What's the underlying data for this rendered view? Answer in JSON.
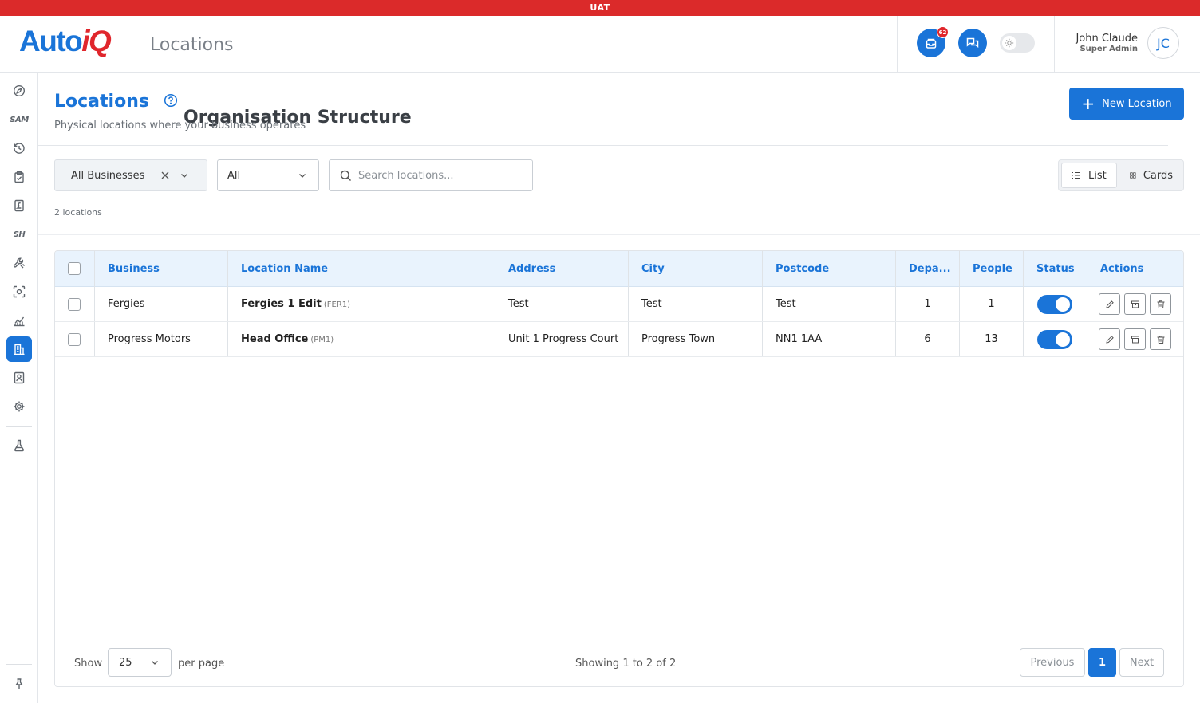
{
  "env": {
    "label": "UAT"
  },
  "brand": {
    "logo_auto": "Auto",
    "logo_iq": "iQ",
    "primary_color": "#1a74d8",
    "accent_color": "#e0262c",
    "env_color": "#db2a2a"
  },
  "header": {
    "title": "Organisation Structure",
    "subtitle": "Locations",
    "notification_count": "62",
    "user": {
      "name": "John Claude",
      "role": "Super Admin",
      "initials": "JC"
    }
  },
  "sidebar": {
    "items": [
      {
        "icon": "compass-icon"
      },
      {
        "text": "SAM"
      },
      {
        "icon": "history-icon"
      },
      {
        "icon": "clipboard-icon"
      },
      {
        "icon": "pound-invoice-icon"
      },
      {
        "text": "SH"
      },
      {
        "icon": "tools-icon"
      },
      {
        "icon": "scan-icon"
      },
      {
        "icon": "analytics-icon"
      },
      {
        "icon": "building-icon",
        "active": true
      },
      {
        "icon": "contact-book-icon"
      },
      {
        "icon": "gear-icon"
      },
      {
        "icon": "flask-icon"
      },
      {
        "icon": "pin-icon"
      }
    ]
  },
  "page": {
    "title": "Locations",
    "description": "Physical locations where your business operates",
    "new_button": "New Location",
    "count_text": "2 locations"
  },
  "filters": {
    "business": "All Businesses",
    "status": "All",
    "search_placeholder": "Search locations..."
  },
  "view_toggle": {
    "list": "List",
    "cards": "Cards",
    "selected": "List"
  },
  "table": {
    "columns": [
      "Business",
      "Location Name",
      "Address",
      "City",
      "Postcode",
      "Depa...",
      "People",
      "Status",
      "Actions"
    ],
    "rows": [
      {
        "business": "Fergies",
        "name": "Fergies 1 Edit",
        "code": "(FER1)",
        "address": "Test",
        "city": "Test",
        "postcode": "Test",
        "departments": "1",
        "people": "1",
        "status": true
      },
      {
        "business": "Progress Motors",
        "name": "Head Office",
        "code": "(PM1)",
        "address": "Unit 1 Progress Court",
        "city": "Progress Town",
        "postcode": "NN1 1AA",
        "departments": "6",
        "people": "13",
        "status": true
      }
    ]
  },
  "pagination": {
    "show_label": "Show",
    "per_page": "25",
    "per_page_label": "per page",
    "showing": "Showing 1 to 2 of 2",
    "previous": "Previous",
    "current": "1",
    "next": "Next"
  }
}
